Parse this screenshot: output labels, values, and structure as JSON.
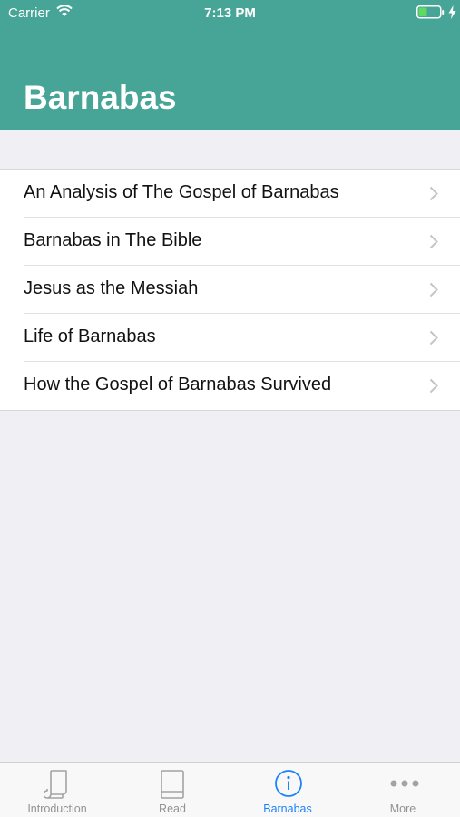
{
  "status_bar": {
    "carrier": "Carrier",
    "time": "7:13 PM"
  },
  "header": {
    "title": "Barnabas",
    "background_color": "#47a597"
  },
  "list": {
    "items": [
      {
        "label": "An Analysis of The Gospel of Barnabas"
      },
      {
        "label": "Barnabas in The Bible"
      },
      {
        "label": "Jesus as the Messiah"
      },
      {
        "label": "Life of Barnabas"
      },
      {
        "label": "How the Gospel of Barnabas Survived"
      }
    ]
  },
  "tab_bar": {
    "active_color": "#1a82fb",
    "inactive_color": "#929292",
    "tabs": [
      {
        "label": "Introduction",
        "icon": "scroll-icon",
        "active": false
      },
      {
        "label": "Read",
        "icon": "book-icon",
        "active": false
      },
      {
        "label": "Barnabas",
        "icon": "info-icon",
        "active": true
      },
      {
        "label": "More",
        "icon": "more-icon",
        "active": false
      }
    ]
  }
}
